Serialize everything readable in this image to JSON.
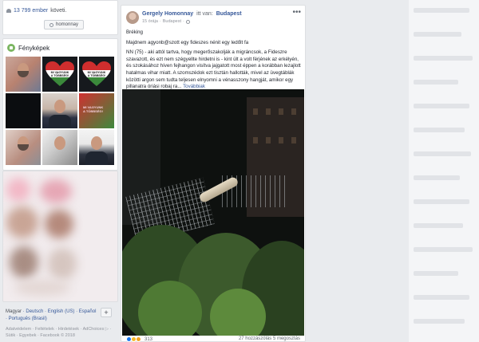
{
  "follow": {
    "count": "13 799 ember",
    "label": "követi."
  },
  "page_chip": {
    "label": "homonnay"
  },
  "photos": {
    "title": "Fényképek"
  },
  "heart_text": {
    "line1": "MI VAGYUNK",
    "line2": "A TÖBBSÉG!"
  },
  "thumb6_text": {
    "line1": "MI VAGYUNK",
    "line2": "A TÖBBSÉG!"
  },
  "languages": {
    "current": "Magyar",
    "items": [
      "Deutsch",
      "English (US)",
      "Español",
      "Português (Brasil)"
    ]
  },
  "footer_links": "Adatvédelem · Feltételek · Hirdetések · AdChoices ▷ · Sütik · Egyebek · Facebook © 2018",
  "post": {
    "author": "Gergely Homonnay",
    "location_prefix": "itt van:",
    "location": "Budapest",
    "time": "15 órája",
    "place": "Budapest",
    "more_glyph": "•••",
    "paragraphs": [
      "Bréking",
      "Majdnem agyonb@szott egy fideszes nénit egy ledőlt fa",
      "NN (75) - aki attól tartva, hogy megerőszakolják a migráncsok, a Fideszre szavazott, és ezt nem szégyellte hirdetni is - kint ült a volt férjének az erkélyén, és szokásához híven fejhangon visítva jajgatott most éppen a korábban lezajlott hatalmas vihar miatt. A szomszédok ezt tisztán hallották, mivel az üvegtáblák közötti argon sem tudta teljesen elnyomni a vénasszony hangját, amikor egy pillanatra óriási robaj ra..."
    ],
    "see_more": "Továbbiak",
    "reactions_count": "313",
    "comments": "27 hozzászólás",
    "shares": "5 megosztás"
  }
}
